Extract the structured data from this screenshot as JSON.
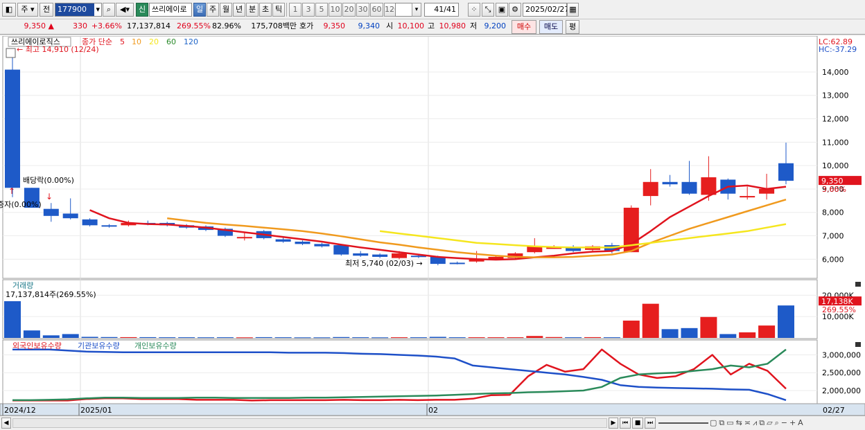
{
  "toolbar": {
    "market": "주",
    "jeon": "전",
    "code": "177900",
    "sin": "신",
    "name": "쓰리에이로",
    "periods": [
      "일",
      "주",
      "월",
      "년",
      "분",
      "초",
      "틱"
    ],
    "active_period": "일",
    "intervals": [
      "1",
      "3",
      "5",
      "10",
      "20",
      "30",
      "60",
      "120"
    ],
    "count": "41",
    "count_total": "/41",
    "date": "2025/02/27"
  },
  "quote": {
    "price": "9,350",
    "change": "330",
    "change_pct": "+3.66%",
    "volume": "17,137,814",
    "volume_ratio": "269.55%",
    "rate2": "82.96%",
    "amount": "175,708백만",
    "hoga_label": "호가",
    "hoga_ask": "9,350",
    "hoga_bid": "9,340",
    "open_label": "시",
    "open": "10,100",
    "high_label": "고",
    "high": "10,980",
    "low_label": "저",
    "low": "9,200",
    "buy_label": "매수",
    "sell_label": "매도",
    "avg_label": "평"
  },
  "chart_data": {
    "type": "candlestick",
    "price_panel": {
      "name": "쓰리에이로직스",
      "indicator_label": "종가 단순",
      "ma_periods": [
        "5",
        "10",
        "20",
        "60",
        "120"
      ],
      "ma_colors": [
        "#e0141e",
        "#f09a1e",
        "#f5e61e",
        "#2a8a2a",
        "#1e64c8"
      ],
      "y_ticks": [
        "14,000",
        "13,000",
        "12,000",
        "11,000",
        "10,000",
        "9,000",
        "8,000",
        "7,000",
        "6,000"
      ],
      "ylim": [
        5300,
        15300
      ],
      "lc": "LC:62.89",
      "hc": "HC:-37.29",
      "high_note": "최고 14,910 (12/24)",
      "low_note": "최저 5,740 (02/03)",
      "dividend_note": "배당락(0.00%)",
      "rights_note": "증자(0.00%)",
      "price_tag": "9,350",
      "pct_tag": "3.66%",
      "candles": [
        {
          "o": 14100,
          "h": 14910,
          "l": 8650,
          "c": 9050
        },
        {
          "o": 9050,
          "h": 9050,
          "l": 8200,
          "c": 8200
        },
        {
          "o": 8150,
          "h": 8400,
          "l": 7600,
          "c": 7850
        },
        {
          "o": 7950,
          "h": 8600,
          "l": 7700,
          "c": 7750
        },
        {
          "o": 7700,
          "h": 7750,
          "l": 7400,
          "c": 7450
        },
        {
          "o": 7450,
          "h": 7500,
          "l": 7350,
          "c": 7400
        },
        {
          "o": 7450,
          "h": 7650,
          "l": 7400,
          "c": 7550
        },
        {
          "o": 7550,
          "h": 7650,
          "l": 7450,
          "c": 7500
        },
        {
          "o": 7550,
          "h": 7600,
          "l": 7400,
          "c": 7450
        },
        {
          "o": 7450,
          "h": 7500,
          "l": 7300,
          "c": 7350
        },
        {
          "o": 7400,
          "h": 7450,
          "l": 7200,
          "c": 7250
        },
        {
          "o": 7300,
          "h": 7350,
          "l": 6950,
          "c": 7000
        },
        {
          "o": 6950,
          "h": 7150,
          "l": 6800,
          "c": 6950
        },
        {
          "o": 7200,
          "h": 7250,
          "l": 6850,
          "c": 6900
        },
        {
          "o": 6850,
          "h": 6950,
          "l": 6700,
          "c": 6750
        },
        {
          "o": 6750,
          "h": 6800,
          "l": 6600,
          "c": 6650
        },
        {
          "o": 6650,
          "h": 6700,
          "l": 6500,
          "c": 6550
        },
        {
          "o": 6600,
          "h": 6650,
          "l": 6150,
          "c": 6200
        },
        {
          "o": 6250,
          "h": 6350,
          "l": 6100,
          "c": 6150
        },
        {
          "o": 6200,
          "h": 6250,
          "l": 6050,
          "c": 6100
        },
        {
          "o": 6050,
          "h": 6350,
          "l": 6000,
          "c": 6250
        },
        {
          "o": 6150,
          "h": 6200,
          "l": 6050,
          "c": 6100
        },
        {
          "o": 6100,
          "h": 6150,
          "l": 5740,
          "c": 5800
        },
        {
          "o": 5850,
          "h": 5900,
          "l": 5780,
          "c": 5820
        },
        {
          "o": 5900,
          "h": 6350,
          "l": 5850,
          "c": 6000
        },
        {
          "o": 6000,
          "h": 6150,
          "l": 5950,
          "c": 6100
        },
        {
          "o": 6050,
          "h": 6300,
          "l": 6000,
          "c": 6250
        },
        {
          "o": 6300,
          "h": 6900,
          "l": 6250,
          "c": 6550
        },
        {
          "o": 6500,
          "h": 6600,
          "l": 6450,
          "c": 6500
        },
        {
          "o": 6500,
          "h": 6600,
          "l": 6300,
          "c": 6350
        },
        {
          "o": 6400,
          "h": 6600,
          "l": 6350,
          "c": 6550
        },
        {
          "o": 6600,
          "h": 6700,
          "l": 6250,
          "c": 6350
        },
        {
          "o": 6300,
          "h": 8300,
          "l": 6300,
          "c": 8200
        },
        {
          "o": 8700,
          "h": 9850,
          "l": 8300,
          "c": 9300
        },
        {
          "o": 9300,
          "h": 9600,
          "l": 9100,
          "c": 9200
        },
        {
          "o": 9300,
          "h": 10200,
          "l": 8750,
          "c": 8800
        },
        {
          "o": 8750,
          "h": 10400,
          "l": 8500,
          "c": 9500
        },
        {
          "o": 9400,
          "h": 9450,
          "l": 8550,
          "c": 8800
        },
        {
          "o": 8700,
          "h": 9100,
          "l": 8550,
          "c": 8700
        },
        {
          "o": 8800,
          "h": 9650,
          "l": 8550,
          "c": 9000
        },
        {
          "o": 10100,
          "h": 10980,
          "l": 9200,
          "c": 9350
        }
      ],
      "ma5": [
        null,
        null,
        null,
        null,
        8100,
        7750,
        7550,
        7500,
        7480,
        7420,
        7350,
        7250,
        7150,
        7050,
        6950,
        6850,
        6750,
        6620,
        6500,
        6400,
        6300,
        6200,
        6100,
        6050,
        6000,
        5980,
        6000,
        6080,
        6150,
        6250,
        6320,
        6350,
        6650,
        7200,
        7800,
        8250,
        8700,
        9100,
        9150,
        9000,
        9100
      ],
      "ma10": [
        null,
        null,
        null,
        null,
        null,
        null,
        null,
        null,
        7750,
        7650,
        7550,
        7480,
        7420,
        7350,
        7280,
        7200,
        7100,
        6980,
        6850,
        6720,
        6620,
        6500,
        6400,
        6300,
        6220,
        6150,
        6100,
        6080,
        6080,
        6100,
        6150,
        6200,
        6350,
        6700,
        7000,
        7300,
        7550,
        7800,
        8050,
        8300,
        8550
      ],
      "ma20": [
        null,
        null,
        null,
        null,
        null,
        null,
        null,
        null,
        null,
        null,
        null,
        null,
        null,
        null,
        null,
        null,
        null,
        null,
        null,
        7200,
        7100,
        7000,
        6900,
        6800,
        6700,
        6650,
        6600,
        6550,
        6520,
        6500,
        6500,
        6500,
        6600,
        6700,
        6800,
        6900,
        7000,
        7100,
        7200,
        7350,
        7500
      ]
    },
    "volume_panel": {
      "title": "거래량",
      "first_note": "17,137,814주(269.55%)",
      "y_ticks": [
        "20,000K",
        "10,000K"
      ],
      "ylim": [
        0,
        24000
      ],
      "tag": "17,138K",
      "tag_pct": "269.55%",
      "values": [
        17200,
        3500,
        1200,
        1800,
        500,
        400,
        350,
        350,
        300,
        300,
        280,
        300,
        250,
        350,
        300,
        250,
        250,
        400,
        300,
        250,
        300,
        300,
        500,
        300,
        300,
        300,
        300,
        900,
        400,
        300,
        350,
        300,
        8100,
        16000,
        4100,
        4600,
        9800,
        1800,
        2600,
        5800,
        15200
      ]
    },
    "holdings_panel": {
      "series_labels": [
        "외국인보유수량",
        "기관보유수량",
        "개인보유수량"
      ],
      "series_colors": [
        "#e0141e",
        "#1e50c8",
        "#2a8a5a"
      ],
      "y_ticks": [
        "3,000,000",
        "2,500,000",
        "2,000,000"
      ],
      "ylim": [
        1650000,
        3300000
      ],
      "foreign": [
        1720000,
        1720000,
        1720000,
        1720000,
        1760000,
        1780000,
        1780000,
        1760000,
        1760000,
        1760000,
        1740000,
        1740000,
        1740000,
        1720000,
        1730000,
        1730000,
        1730000,
        1730000,
        1740000,
        1730000,
        1730000,
        1740000,
        1730000,
        1740000,
        1740000,
        1770000,
        1870000,
        1880000,
        2400000,
        2720000,
        2530000,
        2600000,
        3150000,
        2750000,
        2450000,
        2350000,
        2400000,
        2600000,
        3000000,
        2450000,
        2750000,
        2550000,
        2050000
      ],
      "institution": [
        3150000,
        3150000,
        3150000,
        3120000,
        3090000,
        3080000,
        3070000,
        3070000,
        3070000,
        3070000,
        3070000,
        3070000,
        3070000,
        3070000,
        3070000,
        3060000,
        3060000,
        3060000,
        3050000,
        3030000,
        3020000,
        3000000,
        2980000,
        2950000,
        2900000,
        2700000,
        2650000,
        2600000,
        2550000,
        2500000,
        2450000,
        2380000,
        2300000,
        2150000,
        2100000,
        2080000,
        2070000,
        2060000,
        2050000,
        2030000,
        2020000,
        1900000,
        1730000
      ],
      "individual": [
        1730000,
        1730000,
        1740000,
        1750000,
        1780000,
        1800000,
        1800000,
        1790000,
        1790000,
        1790000,
        1800000,
        1800000,
        1790000,
        1790000,
        1790000,
        1790000,
        1800000,
        1800000,
        1810000,
        1820000,
        1830000,
        1840000,
        1850000,
        1860000,
        1880000,
        1900000,
        1920000,
        1930000,
        1950000,
        1960000,
        1980000,
        2000000,
        2100000,
        2350000,
        2450000,
        2480000,
        2500000,
        2550000,
        2600000,
        2700000,
        2650000,
        2750000,
        3150000
      ]
    },
    "x_labels": [
      "2024/12",
      "2025/01",
      "02"
    ],
    "last_date": "02/27"
  },
  "colors": {
    "up": "#e61e1e",
    "down": "#1e5ac8",
    "grid": "#d8d8d8",
    "axis_bg": "#ffffff"
  }
}
